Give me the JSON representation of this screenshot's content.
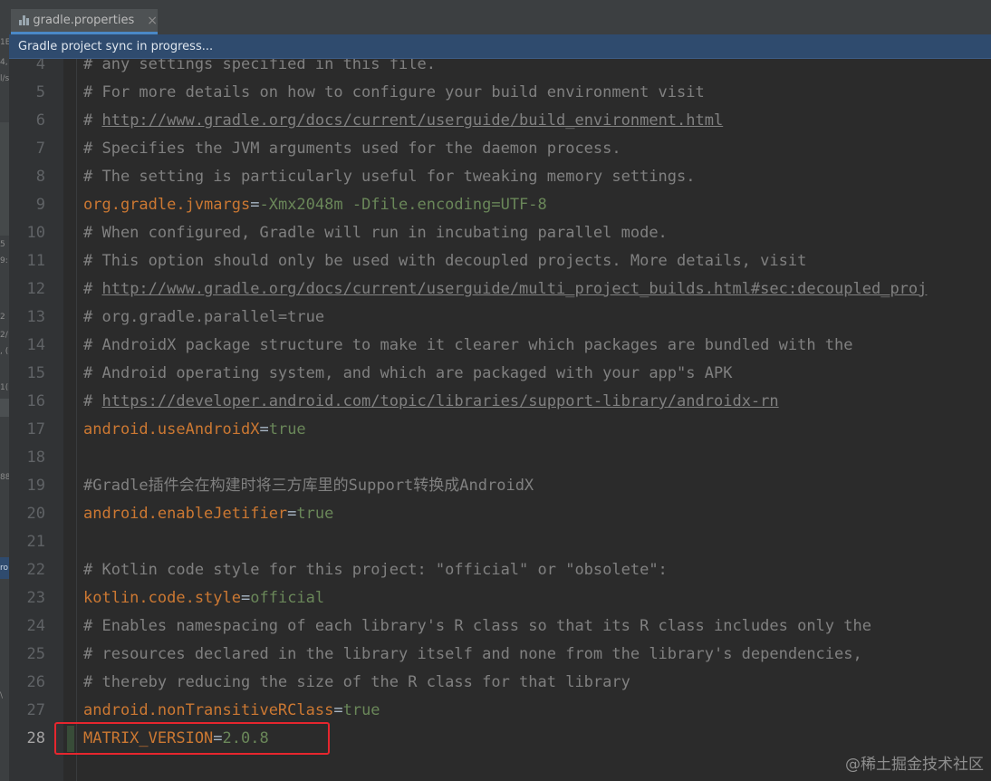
{
  "tab": {
    "label": "gradle.properties",
    "close": "×"
  },
  "banner": {
    "text": "Gradle project sync in progress..."
  },
  "gutter": {
    "lines": [
      "4",
      "5",
      "6",
      "7",
      "8",
      "9",
      "10",
      "11",
      "12",
      "13",
      "14",
      "15",
      "16",
      "17",
      "18",
      "19",
      "20",
      "21",
      "22",
      "23",
      "24",
      "25",
      "26",
      "27",
      "28"
    ],
    "current_line": "28"
  },
  "code": [
    {
      "n": "4",
      "kind": "comment",
      "text": "# any settings specified in this file."
    },
    {
      "n": "5",
      "kind": "comment",
      "text": "# For more details on how to configure your build environment visit"
    },
    {
      "n": "6",
      "kind": "url",
      "prefix": "# ",
      "text": "http://www.gradle.org/docs/current/userguide/build_environment.html"
    },
    {
      "n": "7",
      "kind": "comment",
      "text": "# Specifies the JVM arguments used for the daemon process."
    },
    {
      "n": "8",
      "kind": "comment",
      "text": "# The setting is particularly useful for tweaking memory settings."
    },
    {
      "n": "9",
      "kind": "prop",
      "key": "org.gradle.jvmargs",
      "value": "-Xmx2048m -Dfile.encoding=UTF-8"
    },
    {
      "n": "10",
      "kind": "comment",
      "text": "# When configured, Gradle will run in incubating parallel mode."
    },
    {
      "n": "11",
      "kind": "comment",
      "text": "# This option should only be used with decoupled projects. More details, visit"
    },
    {
      "n": "12",
      "kind": "url",
      "prefix": "# ",
      "text": "http://www.gradle.org/docs/current/userguide/multi_project_builds.html#sec:decoupled_proj"
    },
    {
      "n": "13",
      "kind": "comment",
      "text": "# org.gradle.parallel=true"
    },
    {
      "n": "14",
      "kind": "comment",
      "text": "# AndroidX package structure to make it clearer which packages are bundled with the"
    },
    {
      "n": "15",
      "kind": "comment",
      "text": "# Android operating system, and which are packaged with your app\"s APK"
    },
    {
      "n": "16",
      "kind": "url",
      "prefix": "# ",
      "text": "https://developer.android.com/topic/libraries/support-library/androidx-rn"
    },
    {
      "n": "17",
      "kind": "prop",
      "key": "android.useAndroidX",
      "value": "true"
    },
    {
      "n": "18",
      "kind": "blank",
      "text": ""
    },
    {
      "n": "19",
      "kind": "comment",
      "text": "#Gradle插件会在构建时将三方库里的Support转换成AndroidX"
    },
    {
      "n": "20",
      "kind": "prop",
      "key": "android.enableJetifier",
      "value": "true"
    },
    {
      "n": "21",
      "kind": "blank",
      "text": ""
    },
    {
      "n": "22",
      "kind": "comment",
      "text": "# Kotlin code style for this project: \"official\" or \"obsolete\":"
    },
    {
      "n": "23",
      "kind": "prop",
      "key": "kotlin.code.style",
      "value": "official"
    },
    {
      "n": "24",
      "kind": "comment",
      "text": "# Enables namespacing of each library's R class so that its R class includes only the"
    },
    {
      "n": "25",
      "kind": "comment",
      "text": "# resources declared in the library itself and none from the library's dependencies,"
    },
    {
      "n": "26",
      "kind": "comment",
      "text": "# thereby reducing the size of the R class for that library"
    },
    {
      "n": "27",
      "kind": "prop",
      "key": "android.nonTransitiveRClass",
      "value": "true"
    },
    {
      "n": "28",
      "kind": "prop",
      "key": "MATRIX_VERSION",
      "value": "2.0.8"
    }
  ],
  "operator": "=",
  "watermark": "@稀土掘金技术社区",
  "left_strip_fragments": [
    "1E",
    "4,",
    "l/s",
    "5",
    "9:",
    "2",
    "2/",
    ", (",
    "1(",
    "88",
    "ro",
    "\\"
  ],
  "colors": {
    "background": "#2b2b2b",
    "gutter": "#313335",
    "comment": "#808080",
    "key": "#cc7832",
    "value": "#6a8759",
    "banner": "#2f4b6e",
    "highlight": "#e6262e"
  }
}
